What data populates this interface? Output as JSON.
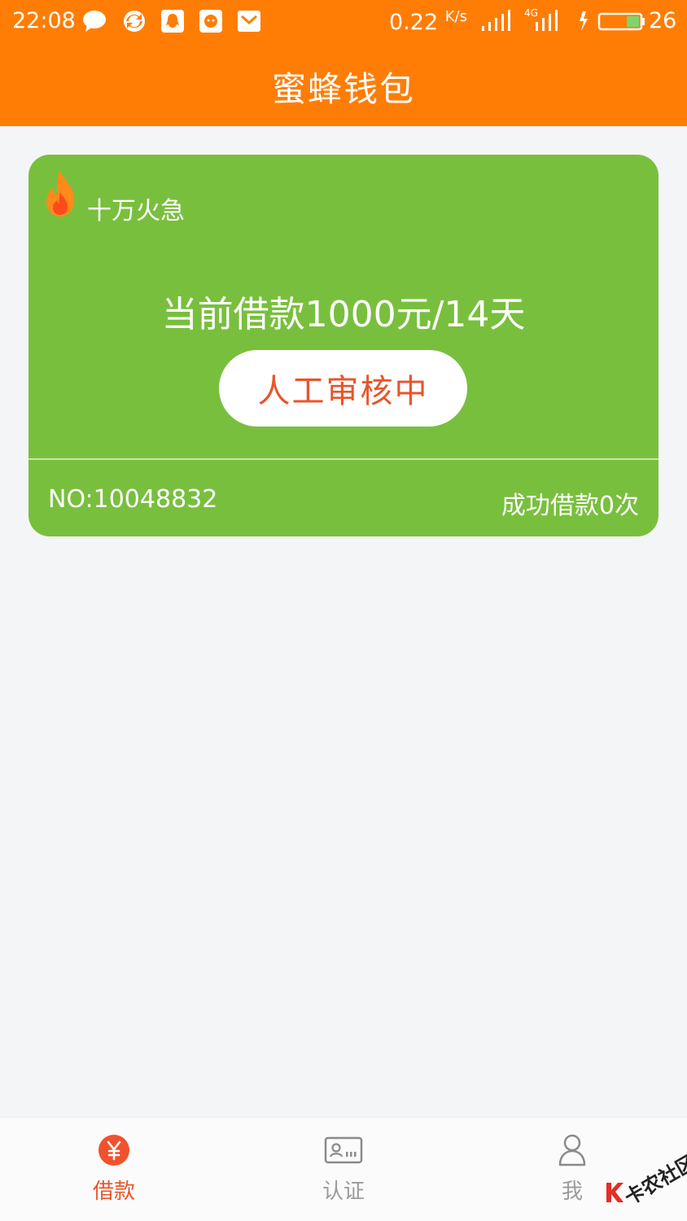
{
  "status_bar": {
    "time": "22:08",
    "net_speed": "0.22",
    "net_speed_unit": "K/s",
    "network_type": "4G",
    "battery_level": "26",
    "icons": [
      "message-bubble-icon",
      "sync-icon",
      "qq-icon",
      "app-icon",
      "mail-icon"
    ]
  },
  "header": {
    "title": "蜜蜂钱包"
  },
  "loan_card": {
    "tag": "十万火急",
    "amount_text": "当前借款1000元/14天",
    "status_button": "人工审核中",
    "number": "NO:10048832",
    "success_count": "成功借款0次",
    "background_color": "#79bf3e"
  },
  "tabs": [
    {
      "label": "借款",
      "icon": "yuan-coin-icon",
      "active": true
    },
    {
      "label": "认证",
      "icon": "id-card-icon",
      "active": false
    },
    {
      "label": "我",
      "icon": "person-icon",
      "active": false
    }
  ],
  "watermark": {
    "text": "卡农社区"
  },
  "colors": {
    "primary": "#ff7d05",
    "accent": "#e8552b",
    "card": "#79bf3e"
  }
}
